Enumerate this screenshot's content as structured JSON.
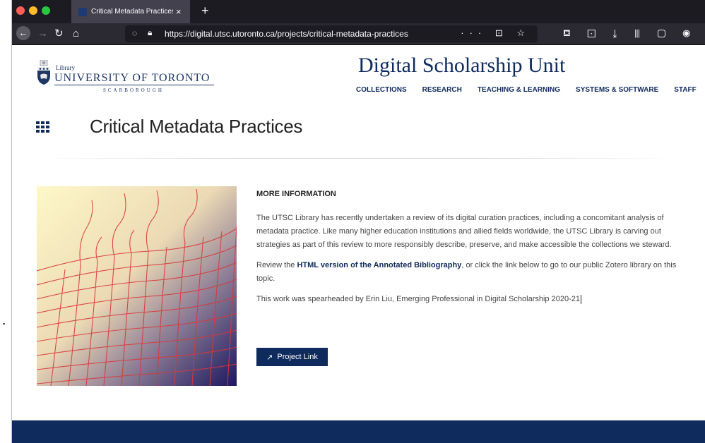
{
  "browser": {
    "tab_title": "Critical Metadata Practices | Di",
    "tab_close": "×",
    "new_tab": "+",
    "url": "https://digital.utsc.utoronto.ca/projects/critical-metadata-practices",
    "url_actions": "··· ⊡ ☆",
    "toolbar": "⛾ ⊡ ⤓ ⫴ ▢ ◉ » ≡",
    "colors": {
      "tabbar": "#1c1b22",
      "navbar": "#2b2a33",
      "close": "#ff5f57",
      "minimize": "#febc2e",
      "zoom": "#28c840"
    }
  },
  "header": {
    "logo_library": "Library",
    "logo_university": "UNIVERSITY OF TORONTO",
    "logo_campus": "SCARBOROUGH",
    "site_title": "Digital Scholarship Unit",
    "nav": [
      "COLLECTIONS",
      "RESEARCH",
      "TEACHING & LEARNING",
      "SYSTEMS & SOFTWARE",
      "STAFF"
    ]
  },
  "main": {
    "page_title": "Critical Metadata Practices",
    "section_heading": "MORE INFORMATION",
    "paragraph_1": "The UTSC Library has recently undertaken a review of its digital curation practices, including a concomitant analysis of metadata practice. Like many higher education institutions and allied fields worldwide, the UTSC Library is carving out strategies as part of this review to more responsibly describe, preserve, and make accessible the collections we steward.",
    "paragraph_2_before": "Review the ",
    "paragraph_2_link": "HTML version of the Annotated Bibliography",
    "paragraph_2_after": ", or click the link below to go to our public Zotero library on this topic.",
    "paragraph_3": "This work was spearheaded by Erin Liu, Emerging Professional in Digital Scholarship 2020-21",
    "project_button": "Project Link",
    "brand_color": "#0f2a5c"
  }
}
